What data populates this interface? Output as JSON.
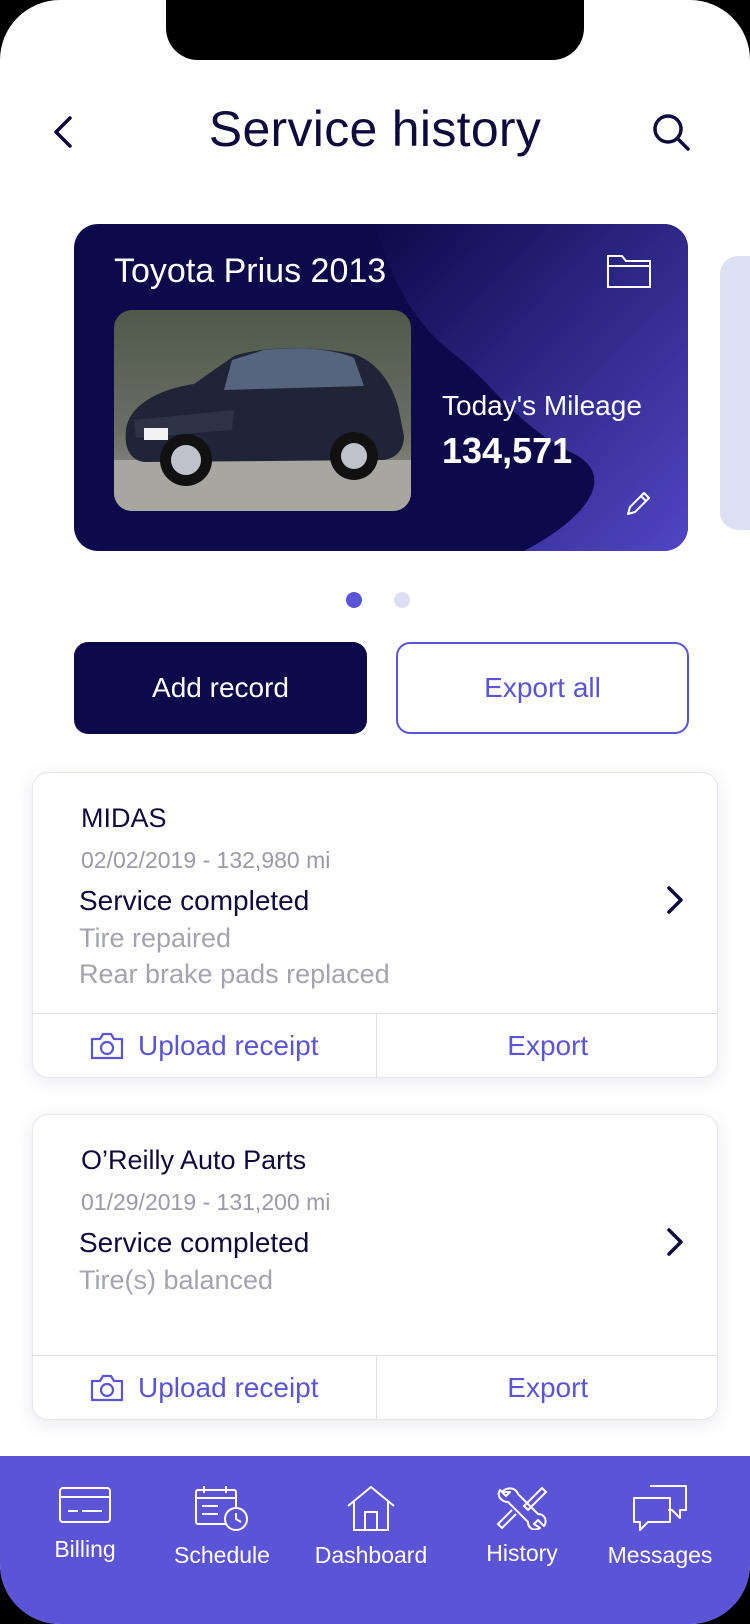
{
  "header": {
    "title": "Service history",
    "back_icon": "chevron-left-icon",
    "search_icon": "search-icon"
  },
  "vehicle": {
    "name": "Toyota Prius 2013",
    "mileage_label": "Today's Mileage",
    "mileage_value": "134,571",
    "photo": "car-photo",
    "folder_icon": "folder-icon",
    "edit_icon": "pencil-icon"
  },
  "pager": {
    "active_index": 0,
    "total": 2
  },
  "actions": {
    "add_record": "Add record",
    "export_all": "Export all"
  },
  "records": [
    {
      "vendor": "MIDAS",
      "meta": "02/02/2019 - 132,980 mi",
      "status": "Service completed",
      "details": [
        "Tire repaired",
        "Rear brake pads replaced"
      ],
      "upload_label": "Upload receipt",
      "export_label": "Export"
    },
    {
      "vendor": "O’Reilly Auto Parts",
      "meta": "01/29/2019 - 131,200 mi",
      "status": "Service completed",
      "details": [
        "Tire(s) balanced"
      ],
      "upload_label": "Upload receipt",
      "export_label": "Export"
    }
  ],
  "tabbar": {
    "items": [
      {
        "label": "Billing",
        "icon": "credit-card-icon"
      },
      {
        "label": "Schedule",
        "icon": "calendar-clock-icon"
      },
      {
        "label": "Dashboard",
        "icon": "home-icon"
      },
      {
        "label": "History",
        "icon": "wrench-tools-icon"
      },
      {
        "label": "Messages",
        "icon": "chat-bubbles-icon"
      }
    ]
  },
  "colors": {
    "primary_dark": "#0c0a4a",
    "accent": "#5b54d6",
    "title_text": "#0f0a3c",
    "muted_text": "#9a9aa8"
  }
}
